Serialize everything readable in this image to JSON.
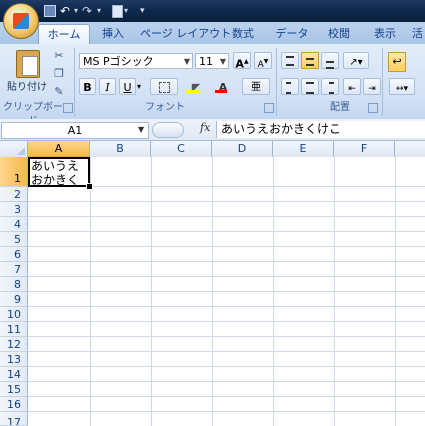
{
  "quick_access": {
    "save_icon": "save-icon",
    "undo_icon": "undo-icon",
    "redo_icon": "redo-icon",
    "print_preview_icon": "print-preview-icon",
    "customize_icon": "customize-icon"
  },
  "tabs": [
    {
      "label": "ホーム",
      "selected": true
    },
    {
      "label": "挿入"
    },
    {
      "label": "ページ レイアウト"
    },
    {
      "label": "数式"
    },
    {
      "label": "データ"
    },
    {
      "label": "校閲"
    },
    {
      "label": "表示"
    },
    {
      "label": "活"
    }
  ],
  "clipboard": {
    "paste_label": "貼り付け",
    "group_label": "クリップボード"
  },
  "font": {
    "name": "MS Pゴシック",
    "size": "11",
    "grow_label": "A",
    "shrink_label": "A",
    "bold_label": "B",
    "italic_label": "I",
    "underline_label": "U",
    "font_color_label": "A",
    "phonetic_label": "亜",
    "group_label": "フォント",
    "font_color": "#ff0000",
    "fill_color": "#ffff00"
  },
  "alignment": {
    "group_label": "配置"
  },
  "formula_bar": {
    "name_box": "A1",
    "fx_label": "fx",
    "content": "あいうえおかきくけこ"
  },
  "grid": {
    "columns": [
      "A",
      "B",
      "C",
      "D",
      "E",
      "F"
    ],
    "selected_column": "A",
    "rows": [
      "1",
      "2",
      "3",
      "4",
      "5",
      "6",
      "7",
      "8",
      "9",
      "10",
      "11",
      "12",
      "13",
      "14",
      "15",
      "16",
      "17"
    ],
    "selected_row": "1",
    "cell_a1": "あいうえおかきくけこ"
  },
  "colors": {
    "tab_text": "#15428b",
    "selection_header": "#f5b94b",
    "gridline": "#d0d7e5"
  }
}
